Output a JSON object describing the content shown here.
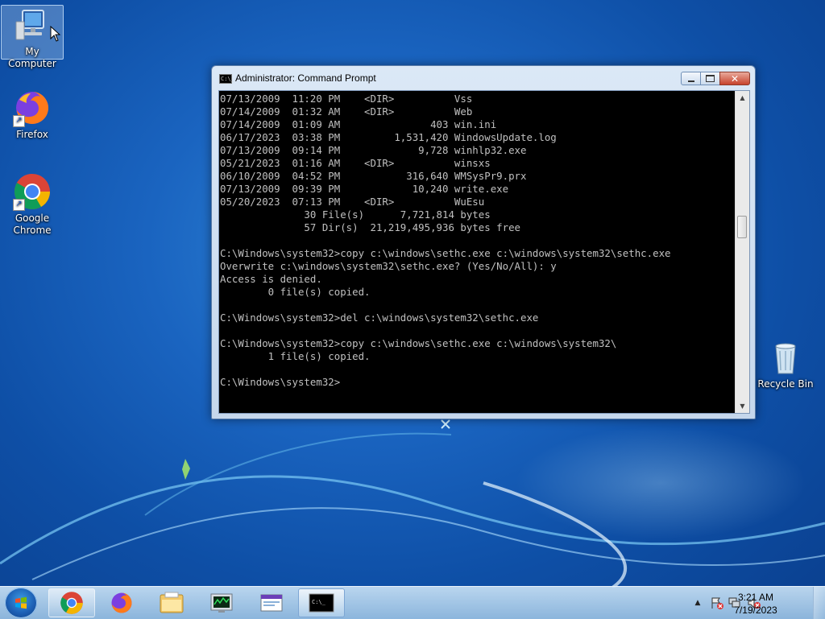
{
  "desktop": {
    "icons": [
      {
        "label": "My Computer",
        "icon": "computer-icon"
      },
      {
        "label": "Firefox",
        "icon": "firefox-icon"
      },
      {
        "label": "Google Chrome",
        "icon": "chrome-icon"
      },
      {
        "label": "Recycle Bin",
        "icon": "recycle-bin-icon"
      }
    ]
  },
  "window": {
    "title": "Administrator:  Command Prompt",
    "console_lines": [
      "07/13/2009  11:20 PM    <DIR>          Vss",
      "07/14/2009  01:32 AM    <DIR>          Web",
      "07/14/2009  01:09 AM               403 win.ini",
      "06/17/2023  03:38 PM         1,531,420 WindowsUpdate.log",
      "07/13/2009  09:14 PM             9,728 winhlp32.exe",
      "05/21/2023  01:16 AM    <DIR>          winsxs",
      "06/10/2009  04:52 PM           316,640 WMSysPr9.prx",
      "07/13/2009  09:39 PM            10,240 write.exe",
      "05/20/2023  07:13 PM    <DIR>          WuEsu",
      "              30 File(s)      7,721,814 bytes",
      "              57 Dir(s)  21,219,495,936 bytes free",
      "",
      "C:\\Windows\\system32>copy c:\\windows\\sethc.exe c:\\windows\\system32\\sethc.exe",
      "Overwrite c:\\windows\\system32\\sethc.exe? (Yes/No/All): y",
      "Access is denied.",
      "        0 file(s) copied.",
      "",
      "C:\\Windows\\system32>del c:\\windows\\system32\\sethc.exe",
      "",
      "C:\\Windows\\system32>copy c:\\windows\\sethc.exe c:\\windows\\system32\\",
      "        1 file(s) copied.",
      "",
      "C:\\Windows\\system32>"
    ]
  },
  "taskbar": {
    "pinned": [
      {
        "icon": "chrome-icon"
      },
      {
        "icon": "firefox-icon"
      },
      {
        "icon": "file-explorer-icon"
      },
      {
        "icon": "task-manager-icon"
      },
      {
        "icon": "control-panel-icon"
      },
      {
        "icon": "command-prompt-icon"
      }
    ],
    "clock": {
      "time": "3:21 AM",
      "date": "7/19/2023"
    }
  }
}
